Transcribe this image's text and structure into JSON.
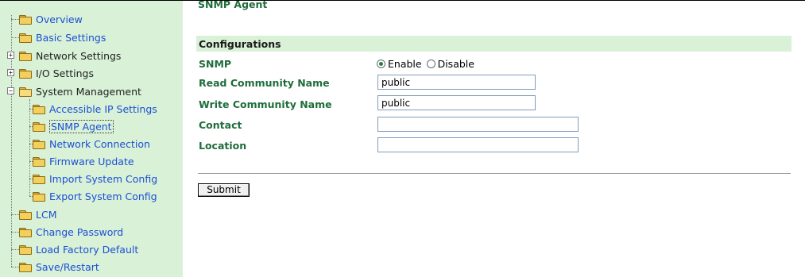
{
  "sidebar": {
    "items": [
      {
        "label": "Overview"
      },
      {
        "label": "Basic Settings"
      },
      {
        "label": "Network Settings",
        "expander": "+"
      },
      {
        "label": "I/O Settings",
        "expander": "+"
      },
      {
        "label": "System Management",
        "expander": "−"
      },
      {
        "label": "Accessible IP Settings"
      },
      {
        "label": "SNMP Agent",
        "selected": true
      },
      {
        "label": "Network Connection"
      },
      {
        "label": "Firmware Update"
      },
      {
        "label": "Import System Config"
      },
      {
        "label": "Export System Config"
      },
      {
        "label": "LCM"
      },
      {
        "label": "Change Password"
      },
      {
        "label": "Load Factory Default"
      },
      {
        "label": "Save/Restart"
      }
    ]
  },
  "main": {
    "title": "SNMP Agent",
    "section": "Configurations",
    "fields": {
      "snmp": {
        "label": "SNMP",
        "options": [
          "Enable",
          "Disable"
        ],
        "selected": "Enable"
      },
      "read_community": {
        "label": "Read Community Name",
        "value": "public"
      },
      "write_community": {
        "label": "Write Community Name",
        "value": "public"
      },
      "contact": {
        "label": "Contact",
        "value": ""
      },
      "location": {
        "label": "Location",
        "value": ""
      }
    },
    "submit_label": "Submit"
  },
  "colors": {
    "sidebar_bg": "#d9f1d7",
    "link": "#1c4fd6",
    "label_green": "#1f6d3a"
  }
}
